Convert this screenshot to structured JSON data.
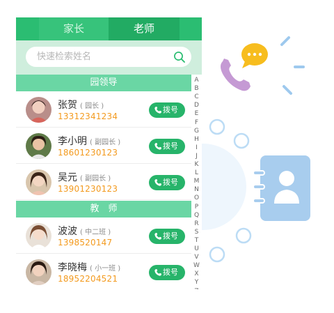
{
  "tabs": [
    {
      "label": "家长",
      "active": false
    },
    {
      "label": "老师",
      "active": true
    }
  ],
  "search": {
    "placeholder": "快速检索姓名",
    "icon": "search-icon"
  },
  "sections": [
    {
      "title": "园领导",
      "contacts": [
        {
          "name": "张贺",
          "role": "( 园长 )",
          "phone": "13312341234",
          "dial_label": "拨号"
        },
        {
          "name": "李小明",
          "role": "( 副园长 )",
          "phone": "18601230123",
          "dial_label": "拨号"
        },
        {
          "name": "吴元",
          "role": "( 副园长 )",
          "phone": "13901230123",
          "dial_label": "拨号"
        }
      ]
    },
    {
      "title": "教　师",
      "contacts": [
        {
          "name": "波波",
          "role": "( 中二班 )",
          "phone": "1398520147",
          "dial_label": "拨号"
        },
        {
          "name": "李晓梅",
          "role": "( 小一班 )",
          "phone": "18952204521",
          "dial_label": "拨号"
        }
      ]
    }
  ],
  "index_letters": [
    "A",
    "B",
    "C",
    "D",
    "E",
    "F",
    "G",
    "H",
    "I",
    "J",
    "K",
    "L",
    "M",
    "N",
    "O",
    "P",
    "Q",
    "R",
    "S",
    "T",
    "U",
    "V",
    "W",
    "X",
    "Y",
    "Z"
  ],
  "colors": {
    "brand_green": "#2bbd72",
    "section_green": "#6ad6a4",
    "phone_orange": "#f39a1e",
    "accent_blue": "#a8cdee",
    "chat_yellow": "#f7bd1e",
    "phone_purple": "#c59ad4"
  },
  "decorations": [
    "phone-handset-icon",
    "chat-bubble-icon",
    "contact-book-icon"
  ]
}
